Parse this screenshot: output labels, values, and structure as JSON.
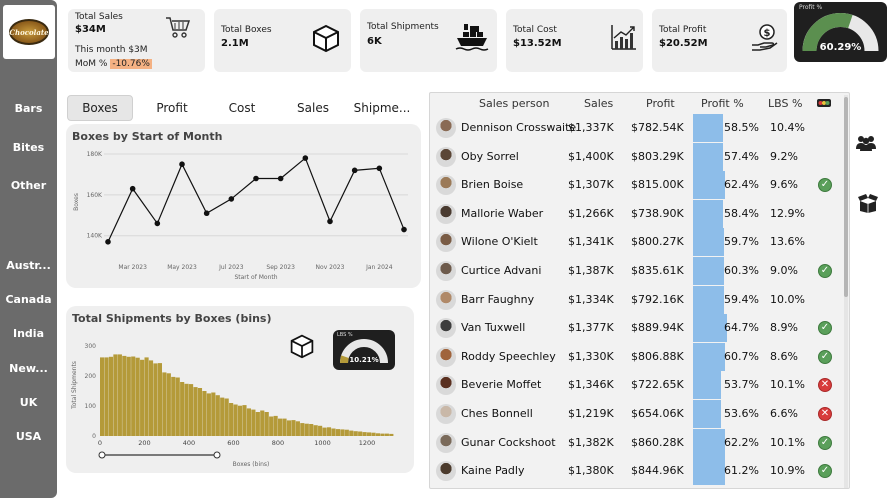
{
  "brand": {
    "logo_text": "Chocolate"
  },
  "sidebar": {
    "items": [
      {
        "label": "Bars"
      },
      {
        "label": "Bites"
      },
      {
        "label": "Other"
      },
      {
        "label": "Austr..."
      },
      {
        "label": "Canada"
      },
      {
        "label": "India"
      },
      {
        "label": "New..."
      },
      {
        "label": "UK"
      },
      {
        "label": "USA"
      }
    ]
  },
  "kpis": {
    "sales": {
      "title": "Total Sales",
      "value": "$34M",
      "this_month": "This month $3M",
      "mom_label": "MoM %",
      "mom_value": "-10.76%",
      "icon": "cart-icon"
    },
    "boxes": {
      "title": "Total Boxes",
      "value": "2.1M",
      "icon": "box-icon"
    },
    "shipments": {
      "title": "Total Shipments",
      "value": "6K",
      "icon": "ship-icon"
    },
    "cost": {
      "title": "Total Cost",
      "value": "$13.52M",
      "icon": "chart-growth-icon"
    },
    "profit": {
      "title": "Total Profit",
      "value": "$20.52M",
      "icon": "money-hand-icon"
    }
  },
  "profit_gauge": {
    "title": "Profit %",
    "value": "60.29%",
    "fraction": 0.6029,
    "color": "#5b8f4f"
  },
  "tabs": [
    {
      "label": "Boxes",
      "active": true
    },
    {
      "label": "Profit"
    },
    {
      "label": "Cost"
    },
    {
      "label": "Sales"
    },
    {
      "label": "Shipme..."
    }
  ],
  "boxes_chart": {
    "title": "Boxes by Start of Month",
    "xlabel": "Start of Month",
    "ylabel": "Boxes",
    "yticks": [
      "180K",
      "160K",
      "140K"
    ],
    "xticks": [
      "Mar 2023",
      "May 2023",
      "Jul 2023",
      "Sep 2023",
      "Nov 2023",
      "Jan 2024"
    ]
  },
  "shipments_chart": {
    "title": "Total Shipments by Boxes (bins)",
    "xlabel": "Boxes (bins)",
    "ylabel": "Total Shipments",
    "yticks": [
      "300",
      "200",
      "100",
      "0"
    ],
    "xticks": [
      "0",
      "200",
      "400",
      "600",
      "800",
      "1000",
      "1200"
    ],
    "mini_gauge": {
      "title": "LBS %",
      "value": "10.21%",
      "fraction": 0.1021
    }
  },
  "chart_data": [
    {
      "type": "line",
      "title": "Boxes by Start of Month",
      "xlabel": "Start of Month",
      "ylabel": "Boxes",
      "x": [
        "Feb 2023",
        "Mar 2023",
        "Apr 2023",
        "May 2023",
        "Jun 2023",
        "Jul 2023",
        "Aug 2023",
        "Sep 2023",
        "Oct 2023",
        "Nov 2023",
        "Dec 2023",
        "Jan 2024",
        "Feb 2024"
      ],
      "values": [
        137000,
        163000,
        146000,
        175000,
        151000,
        158000,
        168000,
        168000,
        178000,
        147000,
        172000,
        173000,
        143000
      ],
      "ylim": [
        133000,
        180000
      ],
      "grid": true,
      "color": "#111111"
    },
    {
      "type": "bar",
      "title": "Total Shipments by Boxes (bins)",
      "xlabel": "Boxes (bins)",
      "ylabel": "Total Shipments",
      "ylim": [
        0,
        340
      ],
      "bin_width": 20,
      "x_start": 0,
      "values": [
        262,
        262,
        264,
        272,
        272,
        267,
        264,
        265,
        261,
        254,
        262,
        252,
        242,
        243,
        212,
        209,
        197,
        195,
        180,
        174,
        173,
        163,
        160,
        150,
        142,
        145,
        136,
        128,
        125,
        110,
        105,
        101,
        103,
        92,
        88,
        80,
        85,
        80,
        65,
        67,
        58,
        58,
        52,
        53,
        49,
        43,
        41,
        40,
        36,
        34,
        28,
        29,
        25,
        23,
        22,
        21,
        18,
        16,
        15,
        13,
        12,
        11,
        9,
        8,
        8,
        7
      ],
      "color": "#b49a39"
    }
  ],
  "table": {
    "headers": [
      "Sales person",
      "Sales",
      "Profit",
      "Profit %",
      "LBS %"
    ],
    "header_icon": "traffic-light-icon",
    "rows": [
      {
        "name": "Dennison Crosswaite",
        "sales": "$1,337K",
        "profit": "$782.54K",
        "profit_pct": "58.5%",
        "profit_frac": 0.585,
        "lbs": "10.4%",
        "status": ""
      },
      {
        "name": "Oby Sorrel",
        "sales": "$1,400K",
        "profit": "$803.29K",
        "profit_pct": "57.4%",
        "profit_frac": 0.574,
        "lbs": "9.2%",
        "status": ""
      },
      {
        "name": "Brien Boise",
        "sales": "$1,307K",
        "profit": "$815.00K",
        "profit_pct": "62.4%",
        "profit_frac": 0.624,
        "lbs": "9.6%",
        "status": "ok"
      },
      {
        "name": "Mallorie Waber",
        "sales": "$1,266K",
        "profit": "$738.90K",
        "profit_pct": "58.4%",
        "profit_frac": 0.584,
        "lbs": "12.9%",
        "status": ""
      },
      {
        "name": "Wilone O'Kielt",
        "sales": "$1,341K",
        "profit": "$800.27K",
        "profit_pct": "59.7%",
        "profit_frac": 0.597,
        "lbs": "13.6%",
        "status": ""
      },
      {
        "name": "Curtice Advani",
        "sales": "$1,387K",
        "profit": "$835.61K",
        "profit_pct": "60.3%",
        "profit_frac": 0.603,
        "lbs": "9.0%",
        "status": "ok"
      },
      {
        "name": "Barr Faughny",
        "sales": "$1,334K",
        "profit": "$792.16K",
        "profit_pct": "59.4%",
        "profit_frac": 0.594,
        "lbs": "10.0%",
        "status": ""
      },
      {
        "name": "Van Tuxwell",
        "sales": "$1,377K",
        "profit": "$889.94K",
        "profit_pct": "64.7%",
        "profit_frac": 0.647,
        "lbs": "8.9%",
        "status": "ok"
      },
      {
        "name": "Roddy Speechley",
        "sales": "$1,330K",
        "profit": "$806.88K",
        "profit_pct": "60.7%",
        "profit_frac": 0.607,
        "lbs": "8.6%",
        "status": "ok"
      },
      {
        "name": "Beverie Moffet",
        "sales": "$1,346K",
        "profit": "$722.65K",
        "profit_pct": "53.7%",
        "profit_frac": 0.537,
        "lbs": "10.1%",
        "status": "bad"
      },
      {
        "name": "Ches Bonnell",
        "sales": "$1,219K",
        "profit": "$654.06K",
        "profit_pct": "53.6%",
        "profit_frac": 0.536,
        "lbs": "6.6%",
        "status": "bad"
      },
      {
        "name": "Gunar Cockshoot",
        "sales": "$1,382K",
        "profit": "$860.28K",
        "profit_pct": "62.2%",
        "profit_frac": 0.622,
        "lbs": "10.1%",
        "status": "ok"
      },
      {
        "name": "Kaine Padly",
        "sales": "$1,380K",
        "profit": "$844.96K",
        "profit_pct": "61.2%",
        "profit_frac": 0.612,
        "lbs": "10.9%",
        "status": "ok"
      }
    ]
  },
  "right_icons": [
    "people-icon",
    "open-box-icon"
  ]
}
